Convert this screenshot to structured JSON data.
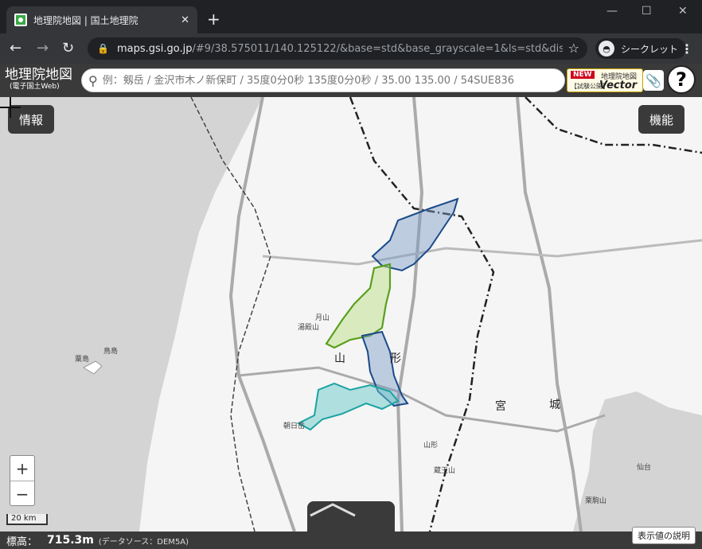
{
  "browser": {
    "tab_title": "地理院地図 | 国土地理院",
    "url_host": "maps.gsi.go.jp",
    "url_path": "/#9/38.575011/140.125122/&base=std&base_grayscale=1&ls=std&disp=...",
    "incognito_label": "シークレット"
  },
  "header": {
    "logo_line1": "地理院地図",
    "logo_line2": "(電子国土Web)",
    "search_placeholder": "例：剱岳 / 金沢市木ノ新保町 / 35度0分0秒 135度0分0秒 / 35.00 135.00 / 54SUE836",
    "vector_new": "NEW",
    "vector_title": "地理院地図",
    "vector_sub": "【試験公開】",
    "vector_word": "Vector"
  },
  "map": {
    "info_button": "情報",
    "function_button": "機能",
    "zoom_in": "+",
    "zoom_out": "−",
    "scale_label": "20 km",
    "labels": {
      "yamagata_1": "山",
      "yamagata_2": "形",
      "miyagi_1": "宮",
      "miyagi_2": "城",
      "gassan": "月山",
      "yudono": "湯殿山",
      "asahi": "朝日岳",
      "awashima": "粟島",
      "torishima": "鳥島",
      "zao": "蔵王山",
      "sendai": "仙台",
      "yamagata_city": "山形",
      "kurikoma": "栗駒山"
    }
  },
  "footer": {
    "elevation_label": "標高：",
    "elevation_value": "715.3m",
    "source": "(データソース：DEM5A)",
    "explain_button": "表示値の説明"
  }
}
